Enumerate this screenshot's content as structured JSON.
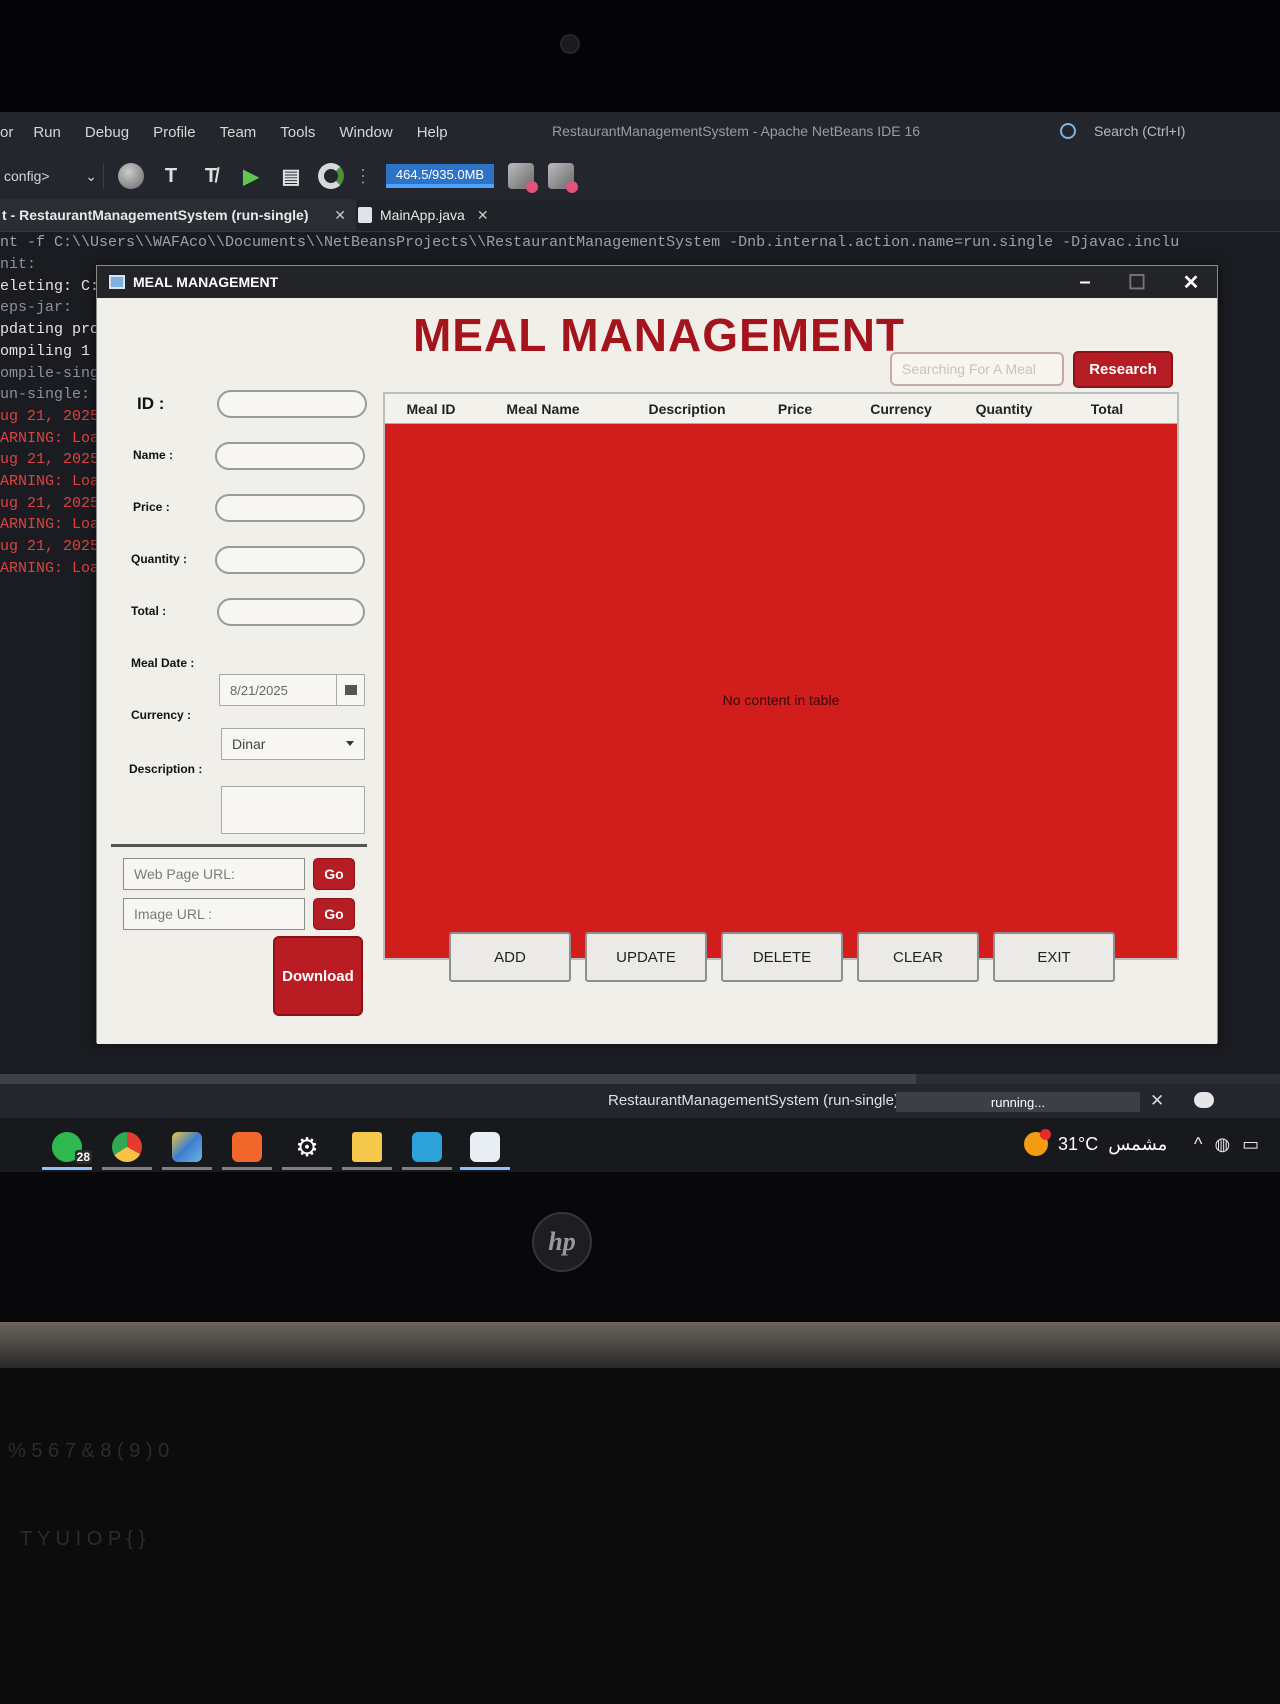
{
  "ide": {
    "menu": [
      "or",
      "Run",
      "Debug",
      "Profile",
      "Team",
      "Tools",
      "Window",
      "Help"
    ],
    "window_title": "RestaurantManagementSystem - Apache NetBeans IDE 16",
    "search_placeholder": "Search (Ctrl+I)",
    "config_label": "config>",
    "memory": "464.5/935.0MB",
    "tabs": [
      {
        "label": "t - RestaurantManagementSystem (run-single)",
        "active": true
      },
      {
        "label": "MainApp.java",
        "active": false
      }
    ],
    "console_command": "nt -f C:\\\\Users\\\\WAFAco\\\\Documents\\\\NetBeansProjects\\\\RestaurantManagementSystem -Dnb.internal.action.name=run.single -Djavac.inclu",
    "console_lines": [
      {
        "text": "nit:",
        "color": "grey"
      },
      {
        "text": "eleting: C:",
        "color": "white"
      },
      {
        "text": "eps-jar:",
        "color": "grey"
      },
      {
        "text": "pdating pro",
        "color": "white"
      },
      {
        "text": "ompiling 1",
        "color": "white"
      },
      {
        "text": "ompile-sing",
        "color": "grey"
      },
      {
        "text": "un-single:",
        "color": "grey"
      },
      {
        "text": "ug 21, 2025",
        "color": "red"
      },
      {
        "text": "ARNING: Loa",
        "color": "red"
      },
      {
        "text": "ug 21, 2025",
        "color": "red"
      },
      {
        "text": "ARNING: Loa",
        "color": "red"
      },
      {
        "text": "ug 21, 2025",
        "color": "red"
      },
      {
        "text": "ARNING: Loa",
        "color": "red"
      },
      {
        "text": "ug 21, 2025",
        "color": "red"
      },
      {
        "text": "ARNING: Loa",
        "color": "red"
      }
    ],
    "run_status": "RestaurantManagementSystem (run-single)",
    "progress_text": "running..."
  },
  "dialog": {
    "window_title": "MEAL MANAGEMENT",
    "heading": "MEAL MANAGEMENT",
    "search_placeholder": "Searching For A Meal",
    "research_label": "Research",
    "form": {
      "id_label": "ID :",
      "name_label": "Name :",
      "price_label": "Price :",
      "quantity_label": "Quantity :",
      "total_label": "Total :",
      "meal_date_label": "Meal Date :",
      "meal_date_value": "8/21/2025",
      "currency_label": "Currency :",
      "currency_value": "Dinar",
      "description_label": "Description :"
    },
    "web_url_placeholder": "Web Page URL:",
    "image_url_placeholder": "Image URL :",
    "go_label": "Go",
    "download_label": "Download",
    "table": {
      "columns": [
        "Meal ID",
        "Meal Name",
        "Description",
        "Price",
        "Currency",
        "Quantity",
        "Total"
      ],
      "empty_message": "No content in table"
    },
    "buttons": {
      "add": "ADD",
      "update": "UPDATE",
      "delete": "DELETE",
      "clear": "CLEAR",
      "exit": "EXIT"
    }
  },
  "taskbar": {
    "apps": [
      "whatsapp-icon",
      "chrome-icon",
      "netbeans-icon",
      "xampp-icon",
      "settings-icon",
      "file-explorer-icon",
      "app-icon",
      "java-icon"
    ],
    "whatsapp_badge": "28",
    "temperature": "31°C",
    "weather_text": "مشمس"
  },
  "colors": {
    "accent_red": "#b41d24",
    "heading_red": "#a3141c",
    "table_red": "#d21d1d",
    "memory_blue": "#2e74c6"
  },
  "laptop": {
    "brand": "hp"
  }
}
